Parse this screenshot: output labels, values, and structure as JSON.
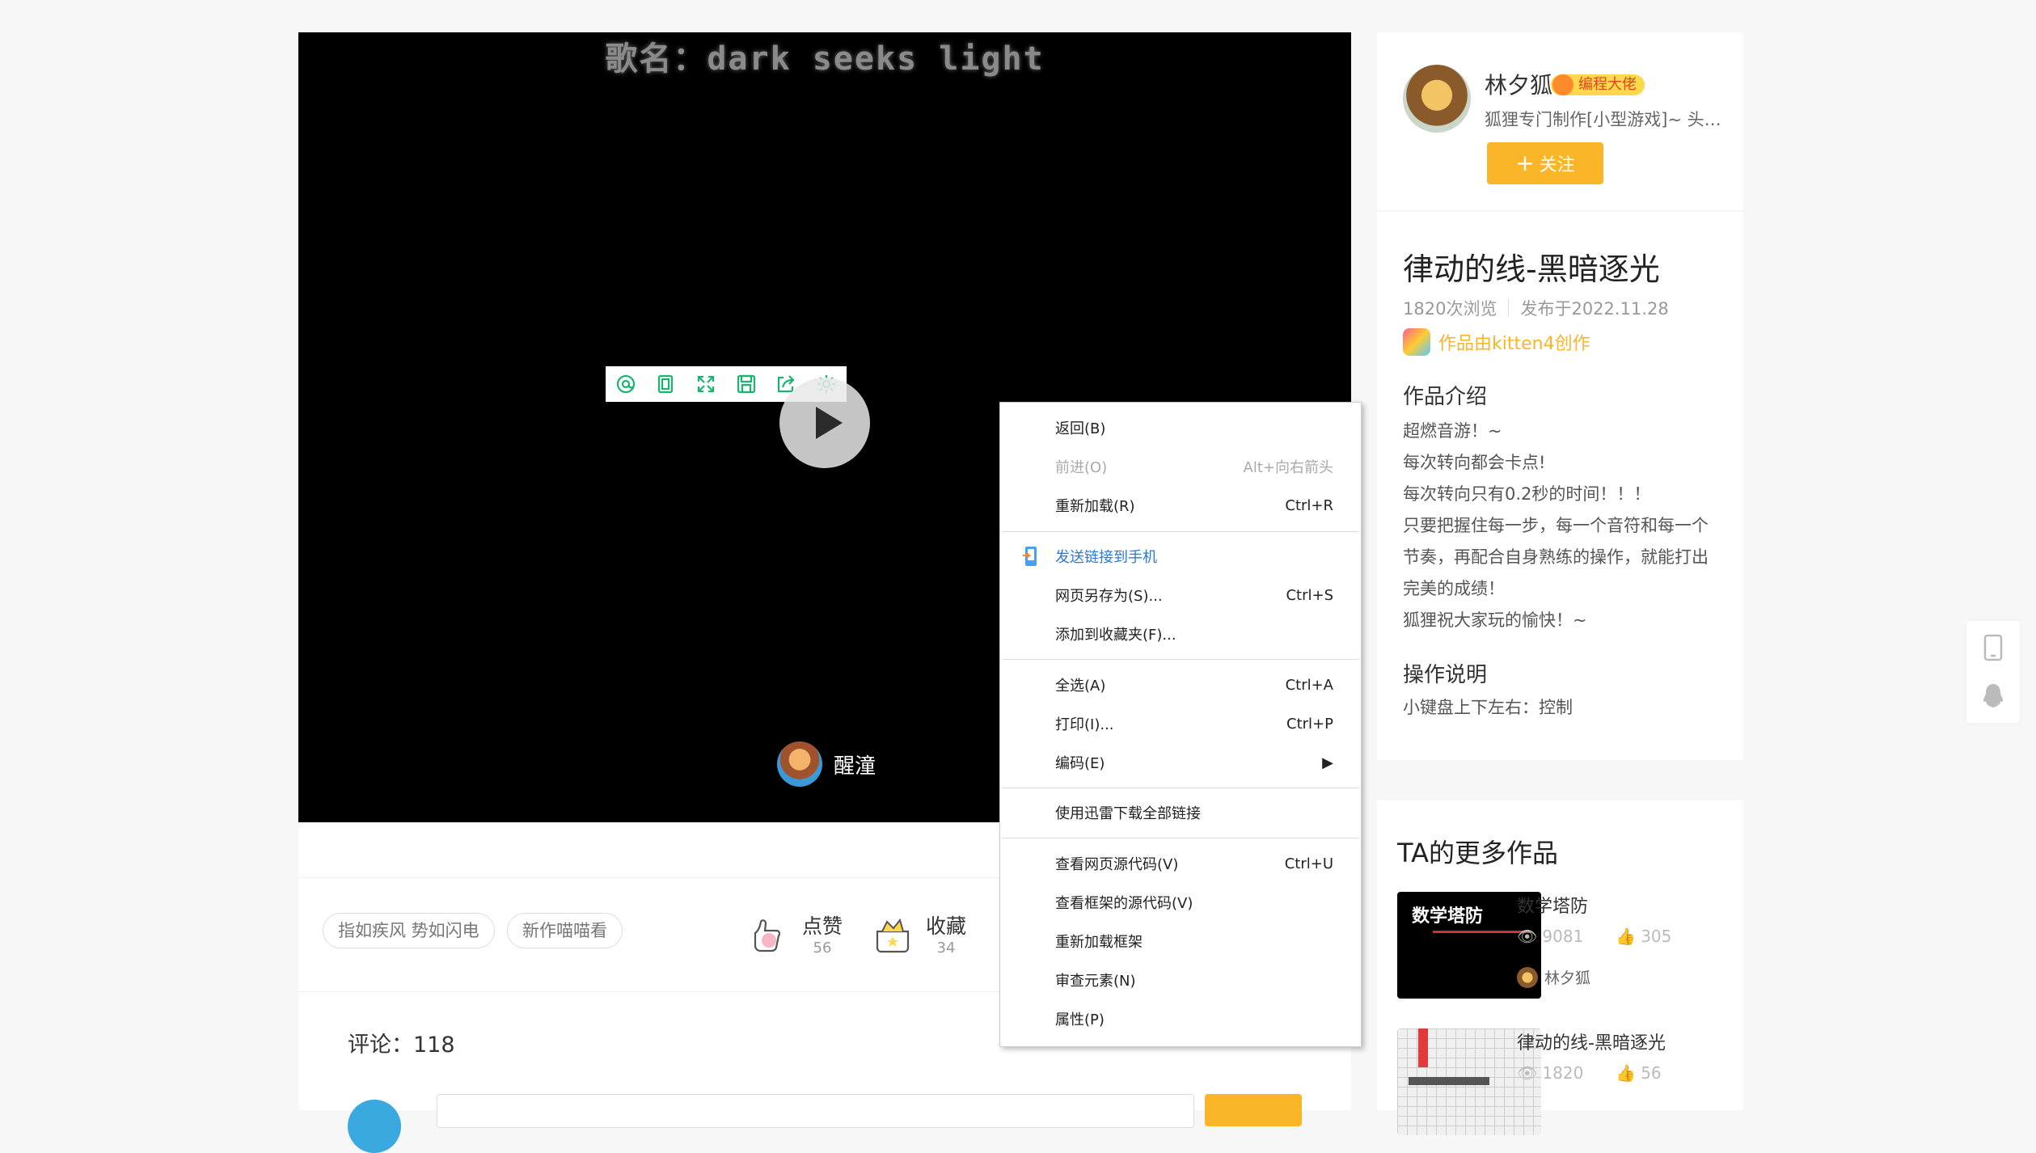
{
  "player": {
    "song_title": "歌名：dark seeks light",
    "toolbar_icons": [
      "doodle-icon",
      "copy-icon",
      "fullscreen-icon",
      "save-icon",
      "share-icon",
      "settings-icon"
    ],
    "author_name": "醒潼"
  },
  "action_bar": {
    "tags": [
      "指如疾风 势如闪电",
      "新作喵喵看"
    ],
    "like": {
      "label": "点赞",
      "count": "56"
    },
    "collect": {
      "label": "收藏",
      "count": "34"
    }
  },
  "comments": {
    "title": "评论：118"
  },
  "profile": {
    "name": "林夕狐",
    "badge": "编程大佬",
    "desc": "狐狸专门制作[小型游戏]~ 头…",
    "follow_label": "关注"
  },
  "work": {
    "title": "律动的线-黑暗逐光",
    "views": "1820次浏览",
    "published": "发布于2022.11.28",
    "made_by": "作品由kitten4创作",
    "intro_title": "作品介绍",
    "intro_lines": [
      "超燃音游！~",
      "每次转向都会卡点!",
      "每次转向只有0.2秒的时间！！！",
      "只要把握住每一步，每一个音符和每一个",
      "节奏，再配合自身熟练的操作，就能打出",
      "完美的成绩！",
      "狐狸祝大家玩的愉快！~"
    ],
    "ops_title": "操作说明",
    "ops_text": "小键盘上下左右：控制"
  },
  "more_works": {
    "title": "TA的更多作品",
    "items": [
      {
        "name": "数学塔防",
        "thumb_text": "数学塔防",
        "views": "9081",
        "likes": "305",
        "author": "林夕狐"
      },
      {
        "name": "律动的线-黑暗逐光",
        "views": "1820",
        "likes": "56"
      }
    ]
  },
  "context_menu": {
    "items": [
      {
        "label": "返回(B)",
        "shortcut": ""
      },
      {
        "label": "前进(O)",
        "shortcut": "Alt+向右箭头"
      },
      {
        "label": "重新加载(R)",
        "shortcut": "Ctrl+R"
      },
      {
        "label": "发送链接到手机",
        "shortcut": ""
      },
      {
        "label": "网页另存为(S)...",
        "shortcut": "Ctrl+S"
      },
      {
        "label": "添加到收藏夹(F)...",
        "shortcut": ""
      },
      {
        "label": "全选(A)",
        "shortcut": "Ctrl+A"
      },
      {
        "label": "打印(I)...",
        "shortcut": "Ctrl+P"
      },
      {
        "label": "编码(E)",
        "shortcut": "▶"
      },
      {
        "label": "使用迅雷下载全部链接",
        "shortcut": ""
      },
      {
        "label": "查看网页源代码(V)",
        "shortcut": "Ctrl+U"
      },
      {
        "label": "查看框架的源代码(V)",
        "shortcut": ""
      },
      {
        "label": "重新加载框架",
        "shortcut": ""
      },
      {
        "label": "审查元素(N)",
        "shortcut": ""
      },
      {
        "label": "属性(P)",
        "shortcut": ""
      }
    ]
  },
  "colors": {
    "accent": "#fbb528",
    "toolbar_icon": "#19b56f",
    "link_blue": "#2979d8"
  }
}
